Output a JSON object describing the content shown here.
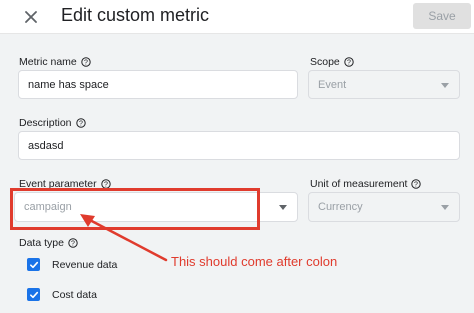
{
  "dialog": {
    "title": "Edit custom metric",
    "save_label": "Save"
  },
  "form": {
    "metric_name": {
      "label": "Metric name",
      "value": "name has space"
    },
    "scope": {
      "label": "Scope",
      "value": "Event"
    },
    "description": {
      "label": "Description",
      "value": "asdasd"
    },
    "event_parameter": {
      "label": "Event parameter",
      "placeholder": "campaign"
    },
    "unit_of_measurement": {
      "label": "Unit of measurement",
      "value": "Currency"
    },
    "data_type": {
      "label": "Data type",
      "options": [
        {
          "label": "Revenue data",
          "checked": true
        },
        {
          "label": "Cost data",
          "checked": true
        }
      ]
    }
  },
  "annotation": {
    "text": "This should come after colon",
    "color": "#e03b2d"
  },
  "colors": {
    "accent": "#1a73e8",
    "panel_background": "#f1f3f4"
  },
  "icons": {
    "close": "close-icon",
    "help": "help-icon",
    "dropdown": "chevron-down-icon",
    "check": "check-icon"
  }
}
